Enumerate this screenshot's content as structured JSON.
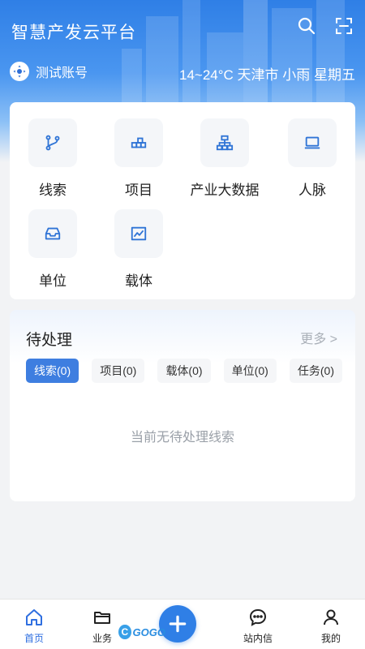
{
  "header": {
    "app_title": "智慧产发云平台",
    "account_label": "测试账号",
    "weather": "14~24°C 天津市 小雨 星期五",
    "search_icon": "search-icon",
    "scan_icon": "scan-icon"
  },
  "menu": {
    "items": [
      {
        "label": "线索",
        "icon": "branch-icon"
      },
      {
        "label": "项目",
        "icon": "blocks-icon"
      },
      {
        "label": "产业大数据",
        "icon": "org-chart-icon"
      },
      {
        "label": "人脉",
        "icon": "laptop-icon"
      },
      {
        "label": "单位",
        "icon": "inbox-icon"
      },
      {
        "label": "载体",
        "icon": "trend-chart-icon"
      }
    ]
  },
  "todo": {
    "title": "待处理",
    "more": "更多 >",
    "tabs": [
      {
        "label": "线索(0)",
        "active": true
      },
      {
        "label": "项目(0)",
        "active": false
      },
      {
        "label": "载体(0)",
        "active": false
      },
      {
        "label": "单位(0)",
        "active": false
      },
      {
        "label": "任务(0)",
        "active": false
      }
    ],
    "empty_text": "当前无待处理线索"
  },
  "tabbar": {
    "items": [
      {
        "label": "首页",
        "icon": "home-icon",
        "active": true
      },
      {
        "label": "业务",
        "icon": "folder-icon",
        "active": false
      },
      {
        "label": "站内信",
        "icon": "message-icon",
        "active": false
      },
      {
        "label": "我的",
        "icon": "user-icon",
        "active": false
      }
    ],
    "fab_icon": "plus-icon",
    "watermark_text": "GOGO"
  },
  "colors": {
    "accent": "#3e7ee0",
    "header_top": "#2f7fe6",
    "icon_blue": "#2f74d6"
  }
}
